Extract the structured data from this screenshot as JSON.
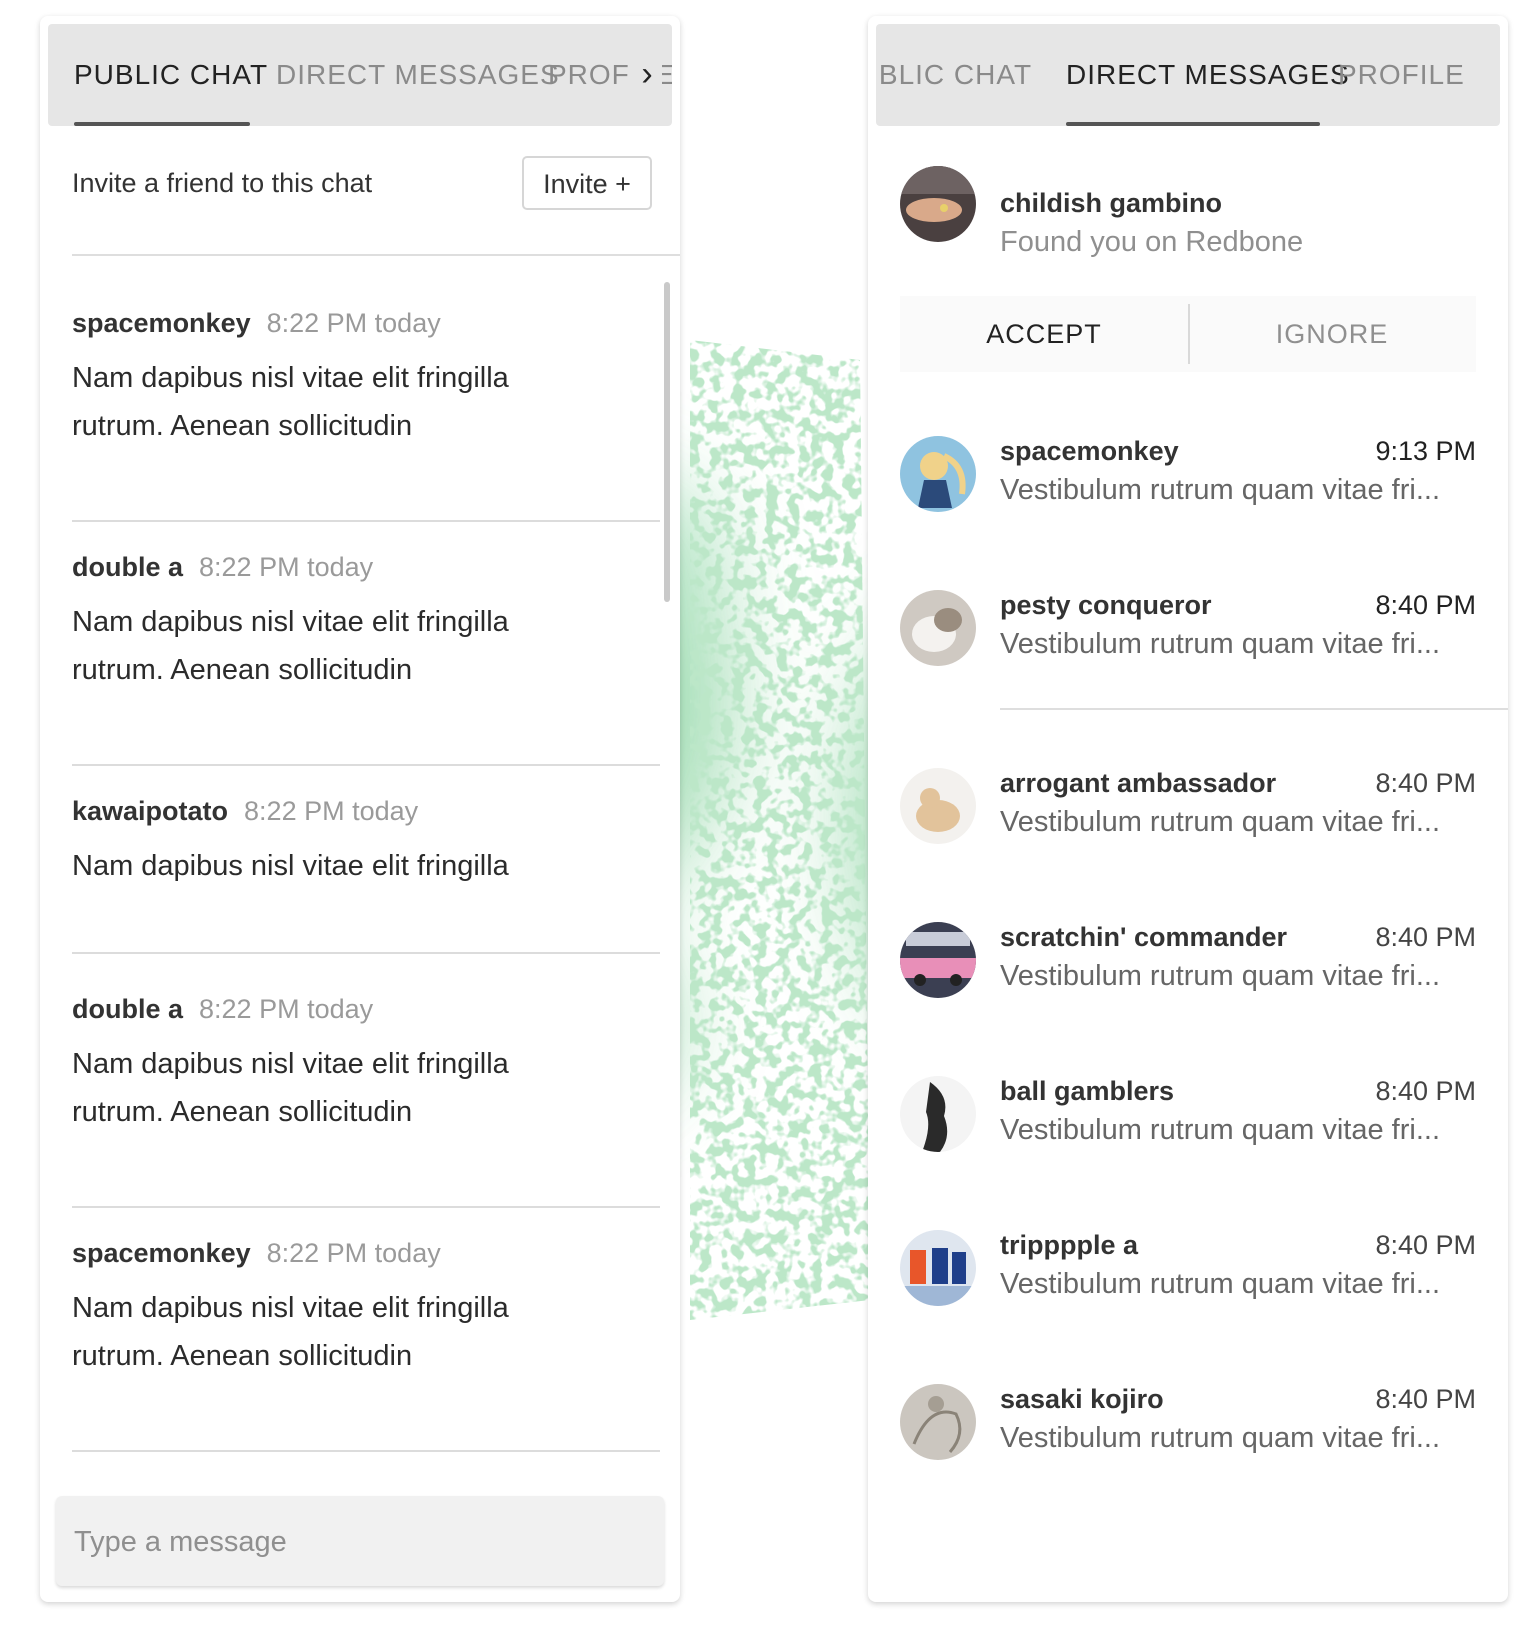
{
  "public_chat_panel": {
    "tabs": [
      "PUBLIC CHAT",
      "DIRECT MESSAGES",
      "PROFILE"
    ],
    "active_tab": "PUBLIC CHAT",
    "invite_text": "Invite a friend to this chat",
    "invite_button": "Invite +",
    "messages": [
      {
        "user": "spacemonkey",
        "time": "8:22 PM today",
        "text": "Nam dapibus nisl vitae elit fringilla rutrum. Aenean sollicitudin"
      },
      {
        "user": "double a",
        "time": "8:22 PM today",
        "text": "Nam dapibus nisl vitae elit fringilla rutrum. Aenean sollicitudin"
      },
      {
        "user": "kawaipotato",
        "time": "8:22 PM today",
        "text": "Nam dapibus nisl vitae elit fringilla"
      },
      {
        "user": "double a",
        "time": "8:22 PM today",
        "text": "Nam dapibus nisl vitae elit fringilla rutrum. Aenean sollicitudin"
      },
      {
        "user": "spacemonkey",
        "time": "8:22 PM today",
        "text": "Nam dapibus nisl vitae elit fringilla rutrum. Aenean sollicitudin"
      }
    ],
    "composer_placeholder": "Type a message"
  },
  "direct_messages_panel": {
    "tabs": [
      "PUBLIC CHAT",
      "DIRECT MESSAGES",
      "PROFILE"
    ],
    "active_tab": "DIRECT MESSAGES",
    "request": {
      "name": "childish gambino",
      "subtitle": "Found you on Redbone",
      "accept": "ACCEPT",
      "ignore": "IGNORE"
    },
    "conversations": [
      {
        "name": "spacemonkey",
        "time": "9:13 PM",
        "preview": "Vestibulum rutrum quam vitae fri...",
        "unread": true
      },
      {
        "name": "pesty conqueror",
        "time": "8:40 PM",
        "preview": "Vestibulum rutrum quam vitae fri...",
        "unread": true
      },
      {
        "name": "arrogant ambassador",
        "time": "8:40 PM",
        "preview": "Vestibulum rutrum quam vitae fri...",
        "unread": false
      },
      {
        "name": "scratchin' commander",
        "time": "8:40 PM",
        "preview": "Vestibulum rutrum quam vitae fri...",
        "unread": false
      },
      {
        "name": "ball gamblers",
        "time": "8:40 PM",
        "preview": "Vestibulum rutrum quam vitae fri...",
        "unread": false
      },
      {
        "name": "tripppple a",
        "time": "8:40 PM",
        "preview": "Vestibulum rutrum quam vitae fri...",
        "unread": false
      },
      {
        "name": "sasaki kojiro",
        "time": "8:40 PM",
        "preview": "Vestibulum rutrum quam vitae fri...",
        "unread": false
      }
    ]
  },
  "colors": {
    "accent_green": "#7fcf95",
    "tab_bar": "#e6e6e6",
    "muted_text": "#8f8f8f"
  }
}
